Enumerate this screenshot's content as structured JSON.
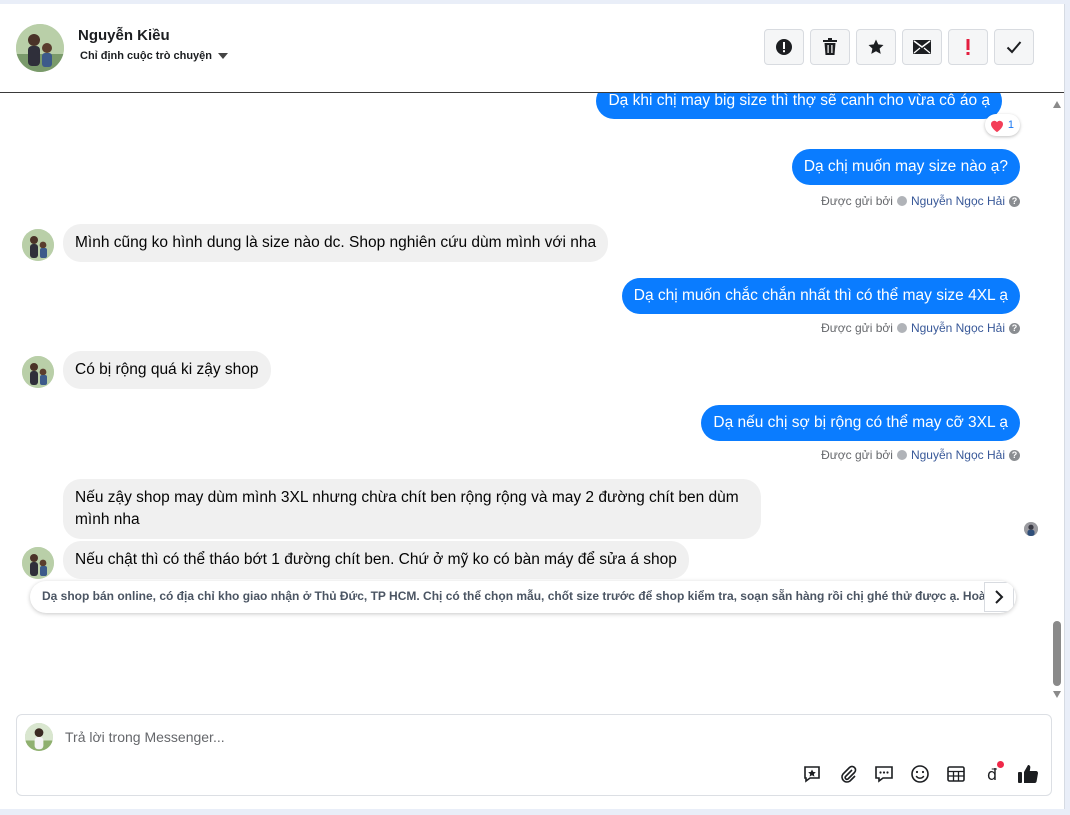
{
  "header": {
    "contact_name": "Nguyễn Kiều",
    "assign_label": "Chỉ định cuộc trò chuyện",
    "actions": [
      {
        "icon": "alert-circle-icon"
      },
      {
        "icon": "trash-icon"
      },
      {
        "icon": "star-icon"
      },
      {
        "icon": "envelope-icon"
      },
      {
        "icon": "exclamation-icon",
        "color": "#e41e3f"
      },
      {
        "icon": "checkmark-icon"
      }
    ]
  },
  "messages": [
    {
      "from": "page",
      "text": "Dạ khi chị may big size thì thợ sẽ canh cho vừa cô áo ạ",
      "reaction": {
        "icon": "heart-icon",
        "count": "1"
      }
    },
    {
      "from": "page",
      "text": "Dạ chị muốn may size nào ạ?",
      "sent_by_prefix": "Được gửi bởi",
      "sent_by": "Nguyễn Ngọc Hải"
    },
    {
      "from": "customer",
      "text": "Mình cũng ko hình dung là size nào dc. Shop nghiên cứu dùm mình với nha"
    },
    {
      "from": "page",
      "text": "Dạ chị muốn chắc chắn nhất thì có thể may size 4XL ạ",
      "sent_by_prefix": "Được gửi bởi",
      "sent_by": "Nguyễn Ngọc Hải"
    },
    {
      "from": "customer",
      "text": "Có bị rộng quá ki zậy shop"
    },
    {
      "from": "page",
      "text": "Dạ nếu chị sợ bị rộng có thể may cỡ 3XL ạ",
      "sent_by_prefix": "Được gửi bởi",
      "sent_by": "Nguyễn Ngọc Hải"
    },
    {
      "from": "customer",
      "text": "Nếu zậy shop may dùm mình 3XL nhưng chừa chít ben rộng rộng và may 2 đường chít ben dùm mình nha"
    },
    {
      "from": "customer",
      "text": "Nếu chật thì có thể tháo bớt 1 đường chít ben. Chứ ở mỹ ko có bàn máy để sửa á shop"
    }
  ],
  "suggestion": {
    "text": "Dạ shop bán online, có địa chỉ kho giao nhận ở Thủ Đức, TP HCM. Chị có thể chọn mẫu, chốt size trước để shop kiểm tra, soạn sẵn hàng rồi chị ghé thử được ạ. Hoà",
    "next_icon": "chevron-right-icon"
  },
  "composer": {
    "placeholder": "Trả lời trong Messenger...",
    "tools": [
      "saved-reply-icon",
      "paperclip-icon",
      "chat-bubble-icon",
      "emoji-icon",
      "table-icon",
      "dong-currency-icon",
      "thumbs-up-icon"
    ]
  },
  "colors": {
    "outgoing_bubble": "#0a7cff",
    "incoming_bubble": "#f0f0f0",
    "link": "#385898"
  }
}
